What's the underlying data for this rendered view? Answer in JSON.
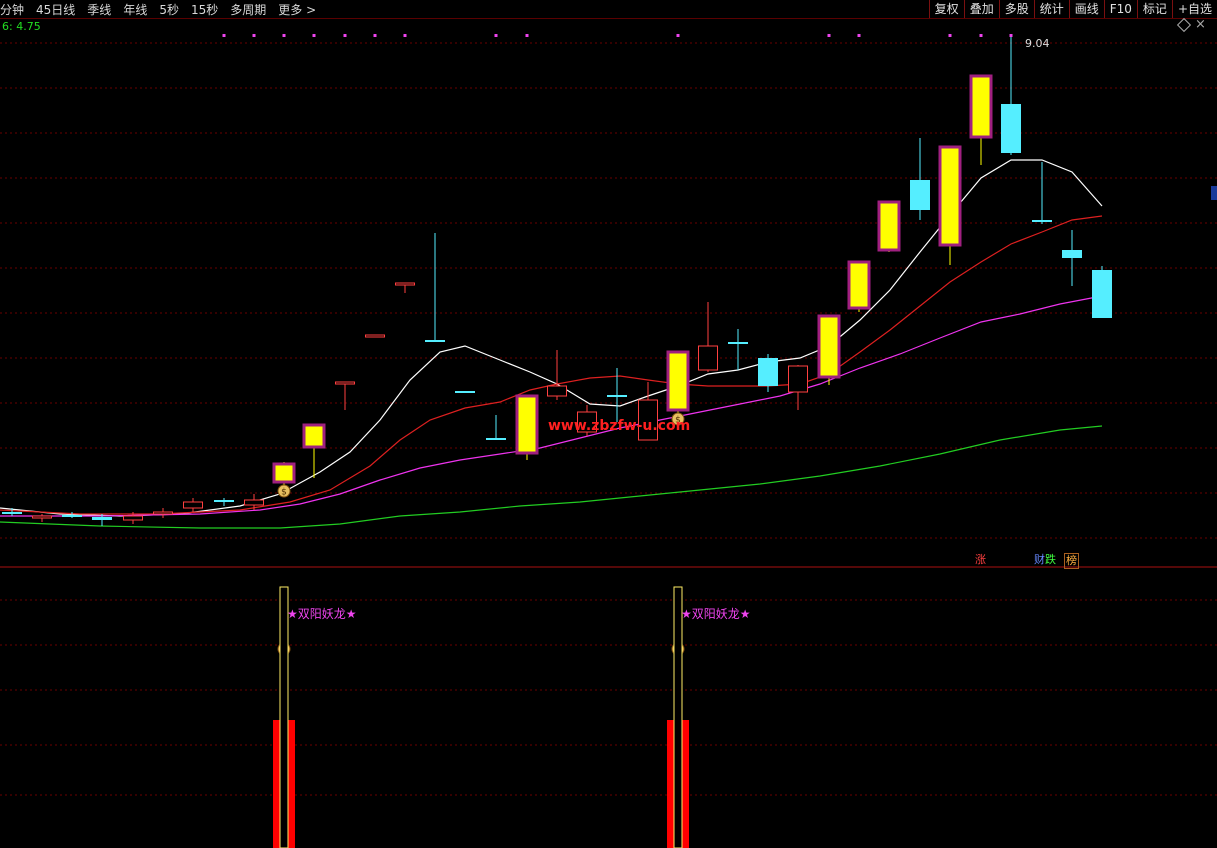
{
  "toolbar": {
    "left_items": [
      "分钟",
      "45日线",
      "季线",
      "年线",
      "5秒",
      "15秒",
      "多周期",
      "更多 >"
    ],
    "right_buttons": [
      "复权",
      "叠加",
      "多股",
      "统计",
      "画线",
      "F10",
      "标记",
      "+自选"
    ]
  },
  "main_chart": {
    "price_label": "6: 4.75",
    "high_label": "9.04",
    "watermark": "www.zbzfw-u.com",
    "tags": {
      "zhang": "涨",
      "cai": "财",
      "die": "跌",
      "bang": "榜"
    },
    "colors": {
      "up_body": "#ffff00",
      "up_border": "#a02080",
      "down_body": "#55eeff",
      "flat_body": "#ff4040",
      "ma5": "#ffffff",
      "ma10": "#dd2020",
      "ma20": "#ee33ee",
      "ma60": "#22cc22",
      "grid": "#6a0000",
      "signal_text": "#ee44ee"
    }
  },
  "indicator": {
    "signal_text": "★双阳妖龙★",
    "signals": [
      {
        "label": "★双阳妖龙★"
      },
      {
        "label": "★双阳妖龙★"
      }
    ]
  }
}
